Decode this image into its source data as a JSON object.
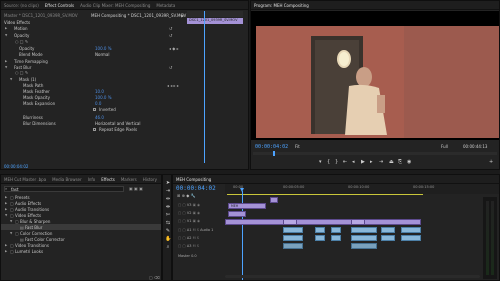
{
  "effect_controls": {
    "tabs": [
      "Source: (no clips)",
      "Effect Controls",
      "Audio Clip Mixer: MEH Compositing",
      "Metadata"
    ],
    "source_clip": "Master * DSC1_1201_0939R_SV.MOV",
    "sequence_clip": "MEH Compositing * DSC1_1201_0939R_SV.MOV",
    "section_title": "Video Effects",
    "timeline_clip_label": "DSC1_1201_0939R_SV.MOV",
    "rows": {
      "motion": "Motion",
      "opacity_group": "Opacity",
      "opacity": "Opacity",
      "opacity_val": "100.0 %",
      "blend_mode": "Blend Mode",
      "blend_mode_val": "Normal",
      "time_remapping": "Time Remapping",
      "fast_blur": "Fast Blur",
      "mask": "Mask (1)",
      "mask_path": "Mask Path",
      "mask_feather": "Mask Feather",
      "mask_feather_val": "10.0",
      "mask_opacity": "Mask Opacity",
      "mask_opacity_val": "100.0 %",
      "mask_expansion": "Mask Expansion",
      "mask_expansion_val": "0.0",
      "inverted": "Inverted",
      "blurriness": "Blurriness",
      "blurriness_val": "46.0",
      "blur_dimensions": "Blur Dimensions",
      "blur_dimensions_val": "Horizontal and Vertical",
      "repeat_edge": "Repeat Edge Pixels"
    },
    "footer_time": "00:00:04:02"
  },
  "program": {
    "tab": "Program: MEH Compositing",
    "timecode": "00:00:04:02",
    "fit": "Fit",
    "quality": "Full",
    "duration": "00:00:44:13"
  },
  "project": {
    "tabs": [
      "MEH Cut Master .bpa",
      "Media Browser",
      "Info",
      "Effects",
      "Markers",
      "History"
    ],
    "search_placeholder": "fast",
    "items": [
      "Presets",
      "Audio Effects",
      "Audio Transitions",
      "Video Effects",
      "Blur & Sharpen",
      "Fast Blur",
      "Color Correction",
      "Fast Color Corrector",
      "Video Transitions",
      "Lumetri Looks"
    ]
  },
  "timeline": {
    "tab": "MEH Compositing",
    "timecode": "00:00:04:02",
    "ruler": [
      "00:00",
      "00:00:05:00",
      "00:00:10:00",
      "00:00:15:00"
    ],
    "tracks": [
      "V3",
      "V2",
      "V1",
      "A1",
      "A2",
      "A3",
      "Master"
    ],
    "audio_track_name": "Audio 1",
    "master_val": "0.0",
    "clip_name": "MEH"
  }
}
